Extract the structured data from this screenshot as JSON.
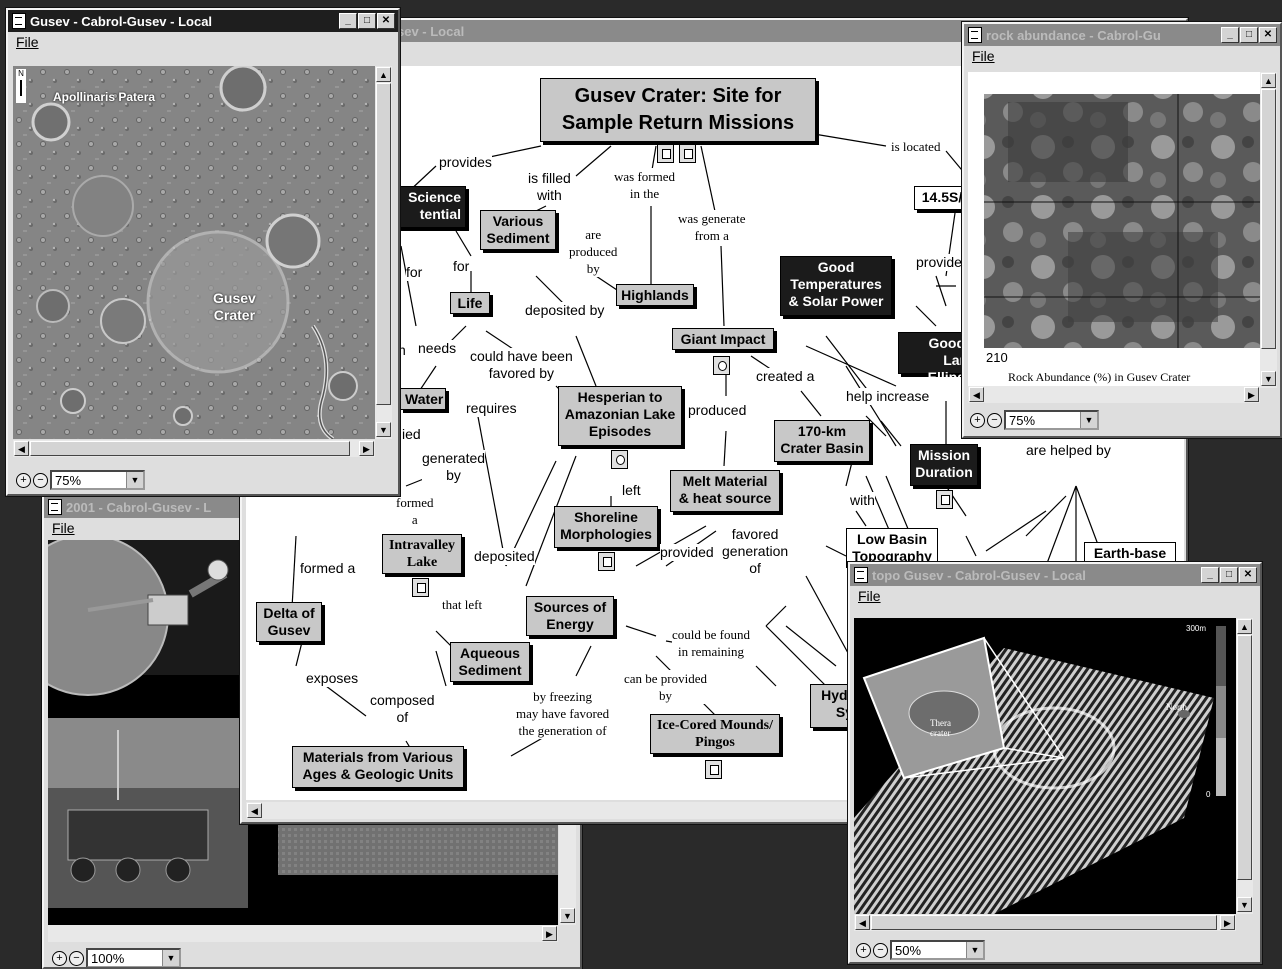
{
  "main_window": {
    "title": "sev - Local",
    "map_title": "Gusev Crater: Site for Sample Return Missions",
    "nodes": {
      "science_potential": "Science\ntential",
      "various_sediment": "Various\nSediment",
      "life": "Life",
      "highlands": "Highlands",
      "giant_impact": "Giant Impact",
      "good_temps": "Good\nTemperatures\n& Solar Power",
      "latlong": "14.5S/",
      "good_landing": "Good Lar\nEllips",
      "water": "Water",
      "hesperian": "Hesperian to\nAmazonian Lake\nEpisodes",
      "basin": "170-km\nCrater Basin",
      "mission_duration": "Mission\nDuration",
      "melt_material": "Melt Material\n& heat source",
      "shoreline": "Shoreline\nMorphologies",
      "intravalley": "Intravalley\nLake",
      "delta": "Delta of\nGusev",
      "sources_energy": "Sources of\nEnergy",
      "aqueous": "Aqueous\nSediment",
      "materials": "Materials from Various\nAges & Geologic Units",
      "ice_mounds": "Ice-Cored Mounds/\nPingos",
      "hydro": "Hydr\nSy",
      "low_basin": "Low Basin\nTopography",
      "earth_based": "Earth-base"
    },
    "links": {
      "provides": "provides",
      "is_filled_with": "is filled\nwith",
      "was_formed_in_the": "was formed\nin the",
      "was_generate_from_a": "was generate\nfrom a",
      "is_located": "is located",
      "are_produced_by": "are\nproduced\nby",
      "for1": "for",
      "for2": "for",
      "deposited_by": "deposited by",
      "provides2": "provide",
      "needs": "needs",
      "n": "n",
      "could_have_been": "could have been\nfavored by",
      "requires": "requires",
      "created_a": "created a",
      "help_increase": "help increase",
      "produced": "produced",
      "ied": "ied",
      "generated_by": "generated\nby",
      "left": "left",
      "formed_a1": "formed\na",
      "formed_a2": "formed a",
      "deposited": "deposited",
      "provided": "provided",
      "favored_generation": "favored\ngeneration\nof",
      "with": "with",
      "are_helped_by": "are helped by",
      "that_left": "that left",
      "could_be_found": "could be found\nin remaining",
      "can_be_provided_by": "can be provided\nby",
      "exposes": "exposes",
      "composed_of": "composed\nof",
      "by_freezing": "by freezing\nmay have favored\nthe generation of"
    }
  },
  "gusev_window": {
    "title": "Gusev - Cabrol-Gusev - Local",
    "menu_file": "File",
    "north": "N",
    "label_apollinaris": "Apollinaris Patera",
    "label_gusev": "Gusev\nCrater",
    "zoom": "75%"
  },
  "rock_window": {
    "title": "rock abundance - Cabrol-Gu",
    "menu_file": "File",
    "axis_value": "210",
    "caption": "Rock Abundance (%) in Gusev Crater",
    "zoom": "75%"
  },
  "photo_window": {
    "title": "2001 - Cabrol-Gusev - L",
    "menu_file": "File",
    "zoom": "100%"
  },
  "topo_window": {
    "title": "topo Gusev - Cabrol-Gusev - Local",
    "menu_file": "File",
    "north": "North",
    "scale_top": "300m",
    "scale_bottom": "0",
    "crater_label": "Thera\ncrater",
    "zoom": "50%"
  }
}
